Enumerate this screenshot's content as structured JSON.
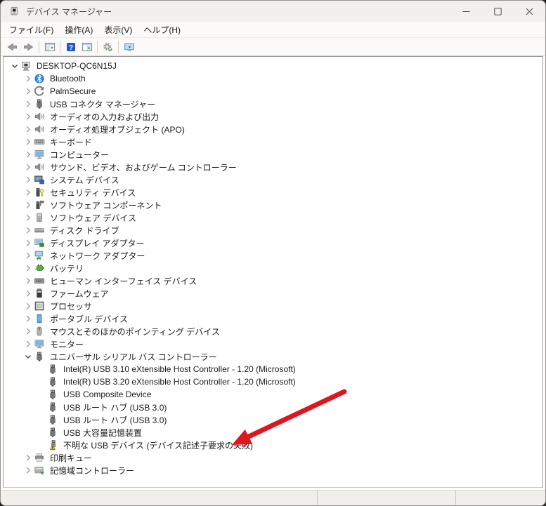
{
  "window": {
    "title": "デバイス マネージャー",
    "controls": [
      "minimize-icon",
      "maximize-icon",
      "close-icon"
    ]
  },
  "menu": {
    "items": [
      "ファイル(F)",
      "操作(A)",
      "表示(V)",
      "ヘルプ(H)"
    ]
  },
  "toolbar": {
    "items": [
      "back-icon",
      "forward-icon",
      "|",
      "console-tree-icon",
      "|",
      "help-icon",
      "action-pane-icon",
      "|",
      "scan-hardware-icon",
      "|",
      "devices-view-icon"
    ]
  },
  "tree": {
    "items": [
      {
        "level": 0,
        "chevron": "expanded",
        "icon": "computer-icon",
        "label": "DESKTOP-QC6N15J"
      },
      {
        "level": 1,
        "chevron": "collapsed",
        "icon": "bluetooth-icon",
        "label": "Bluetooth"
      },
      {
        "level": 1,
        "chevron": "collapsed",
        "icon": "palmsecure-icon",
        "label": "PalmSecure"
      },
      {
        "level": 1,
        "chevron": "collapsed",
        "icon": "usb-icon",
        "label": "USB コネクタ マネージャー"
      },
      {
        "level": 1,
        "chevron": "collapsed",
        "icon": "audio-icon",
        "label": "オーディオの入力および出力"
      },
      {
        "level": 1,
        "chevron": "collapsed",
        "icon": "audio-icon",
        "label": "オーディオ処理オブジェクト (APO)"
      },
      {
        "level": 1,
        "chevron": "collapsed",
        "icon": "keyboard-icon",
        "label": "キーボード"
      },
      {
        "level": 1,
        "chevron": "collapsed",
        "icon": "monitor-icon",
        "label": "コンピューター"
      },
      {
        "level": 1,
        "chevron": "collapsed",
        "icon": "audio-icon",
        "label": "サウンド、ビデオ、およびゲーム コントローラー"
      },
      {
        "level": 1,
        "chevron": "collapsed",
        "icon": "system-icon",
        "label": "システム デバイス"
      },
      {
        "level": 1,
        "chevron": "collapsed",
        "icon": "security-icon",
        "label": "セキュリティ デバイス"
      },
      {
        "level": 1,
        "chevron": "collapsed",
        "icon": "sw-component-icon",
        "label": "ソフトウェア コンポーネント"
      },
      {
        "level": 1,
        "chevron": "collapsed",
        "icon": "sw-device-icon",
        "label": "ソフトウェア デバイス"
      },
      {
        "level": 1,
        "chevron": "collapsed",
        "icon": "disk-icon",
        "label": "ディスク ドライブ"
      },
      {
        "level": 1,
        "chevron": "collapsed",
        "icon": "display-icon",
        "label": "ディスプレイ アダプター"
      },
      {
        "level": 1,
        "chevron": "collapsed",
        "icon": "network-icon",
        "label": "ネットワーク アダプター"
      },
      {
        "level": 1,
        "chevron": "collapsed",
        "icon": "battery-icon",
        "label": "バッテリ"
      },
      {
        "level": 1,
        "chevron": "collapsed",
        "icon": "hid-icon",
        "label": "ヒューマン インターフェイス デバイス"
      },
      {
        "level": 1,
        "chevron": "collapsed",
        "icon": "firmware-icon",
        "label": "ファームウェア"
      },
      {
        "level": 1,
        "chevron": "collapsed",
        "icon": "processor-icon",
        "label": "プロセッサ"
      },
      {
        "level": 1,
        "chevron": "collapsed",
        "icon": "portable-icon",
        "label": "ポータブル デバイス"
      },
      {
        "level": 1,
        "chevron": "collapsed",
        "icon": "mouse-icon",
        "label": "マウスとそのほかのポインティング デバイス"
      },
      {
        "level": 1,
        "chevron": "collapsed",
        "icon": "monitor-icon",
        "label": "モニター"
      },
      {
        "level": 1,
        "chevron": "expanded",
        "icon": "usb-icon",
        "label": "ユニバーサル シリアル バス コントローラー"
      },
      {
        "level": 2,
        "chevron": null,
        "icon": "usb-icon",
        "label": "Intel(R) USB 3.10 eXtensible Host Controller - 1.20 (Microsoft)"
      },
      {
        "level": 2,
        "chevron": null,
        "icon": "usb-icon",
        "label": "Intel(R) USB 3.20 eXtensible Host Controller - 1.20 (Microsoft)"
      },
      {
        "level": 2,
        "chevron": null,
        "icon": "usb-icon",
        "label": "USB Composite Device"
      },
      {
        "level": 2,
        "chevron": null,
        "icon": "usb-icon",
        "label": "USB ルート ハブ (USB 3.0)"
      },
      {
        "level": 2,
        "chevron": null,
        "icon": "usb-icon",
        "label": "USB ルート ハブ (USB 3.0)"
      },
      {
        "level": 2,
        "chevron": null,
        "icon": "usb-icon",
        "label": "USB 大容量記憶装置"
      },
      {
        "level": 2,
        "chevron": null,
        "icon": "usb-warning-icon",
        "label": "不明な USB デバイス (デバイス記述子要求の失敗)"
      },
      {
        "level": 1,
        "chevron": "collapsed",
        "icon": "printer-icon",
        "label": "印刷キュー"
      },
      {
        "level": 1,
        "chevron": "collapsed",
        "icon": "storage-icon",
        "label": "記憶域コントローラー"
      }
    ]
  },
  "annotation": {
    "arrow_color": "#e0161f",
    "arrow_points_at": "不明な USB デバイス (デバイス記述子要求の失敗)"
  },
  "colors": {
    "titlebar_bg": "#f2f0ee",
    "chrome_bg": "#fbfaf9",
    "tree_bg": "#ffffff",
    "statusbar_bg": "#f1efec",
    "warning_yellow": "#f2c21a"
  }
}
